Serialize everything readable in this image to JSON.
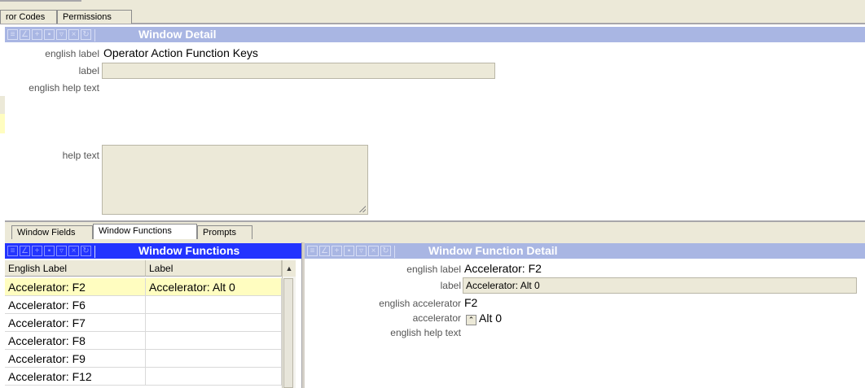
{
  "top_tabs": [
    {
      "label": "ror Codes"
    },
    {
      "label": "Permissions"
    }
  ],
  "window_detail": {
    "title": "Window Detail",
    "english_label_caption": "english label",
    "english_label_value": "Operator Action Function Keys",
    "label_caption": "label",
    "label_value": "",
    "english_help_text_caption": "english help text",
    "help_text_caption": "help text",
    "help_text_value": ""
  },
  "toolbar_icons": [
    "list-icon",
    "edit-icon",
    "add-icon",
    "save-icon",
    "filter-icon",
    "delete-icon",
    "refresh-icon"
  ],
  "sub_tabs": [
    {
      "label": "Window Fields"
    },
    {
      "label": "Window Functions"
    },
    {
      "label": "Prompts"
    }
  ],
  "window_functions": {
    "title": "Window Functions",
    "columns": [
      "English Label",
      "Label"
    ],
    "rows": [
      {
        "english_label": "Accelerator: F2",
        "label": "Accelerator: Alt 0"
      },
      {
        "english_label": "Accelerator: F6",
        "label": ""
      },
      {
        "english_label": "Accelerator: F7",
        "label": ""
      },
      {
        "english_label": "Accelerator: F8",
        "label": ""
      },
      {
        "english_label": "Accelerator: F9",
        "label": ""
      },
      {
        "english_label": "Accelerator: F12",
        "label": ""
      }
    ]
  },
  "window_function_detail": {
    "title": "Window Function Detail",
    "english_label_caption": "english label",
    "english_label_value": "Accelerator: F2",
    "label_caption": "label",
    "label_value": "Accelerator: Alt 0",
    "english_accelerator_caption": "english accelerator",
    "english_accelerator_value": "F2",
    "accelerator_caption": "accelerator",
    "accelerator_value": "Alt 0",
    "english_help_text_caption": "english help text"
  },
  "colors": {
    "header_light": "#a9b6e3",
    "header_dark": "#2334ff",
    "selected_row": "#fffdc0",
    "panel_bg": "#ece9d8"
  }
}
